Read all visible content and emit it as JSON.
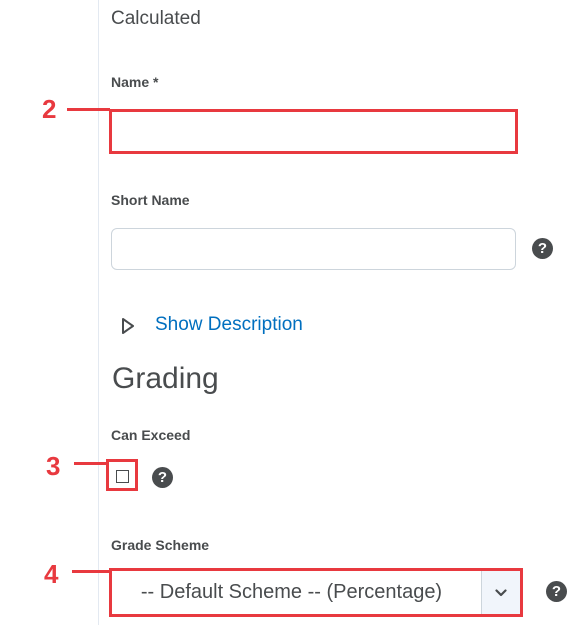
{
  "header": {
    "calculated_label": "Calculated"
  },
  "form": {
    "name": {
      "label": "Name *",
      "value": ""
    },
    "short_name": {
      "label": "Short Name",
      "value": ""
    },
    "show_description": "Show Description",
    "grading_heading": "Grading",
    "can_exceed": {
      "label": "Can Exceed",
      "checked": false
    },
    "grade_scheme": {
      "label": "Grade Scheme",
      "selected": "-- Default Scheme -- (Percentage)"
    },
    "help_glyph": "?"
  },
  "callouts": [
    "2",
    "3",
    "4"
  ],
  "colors": {
    "link": "#006fbf",
    "callout": "#e8393f",
    "text": "#494c4e"
  },
  "icons": [
    "help-icon",
    "disclosure-triangle-icon",
    "chevron-down-icon"
  ]
}
